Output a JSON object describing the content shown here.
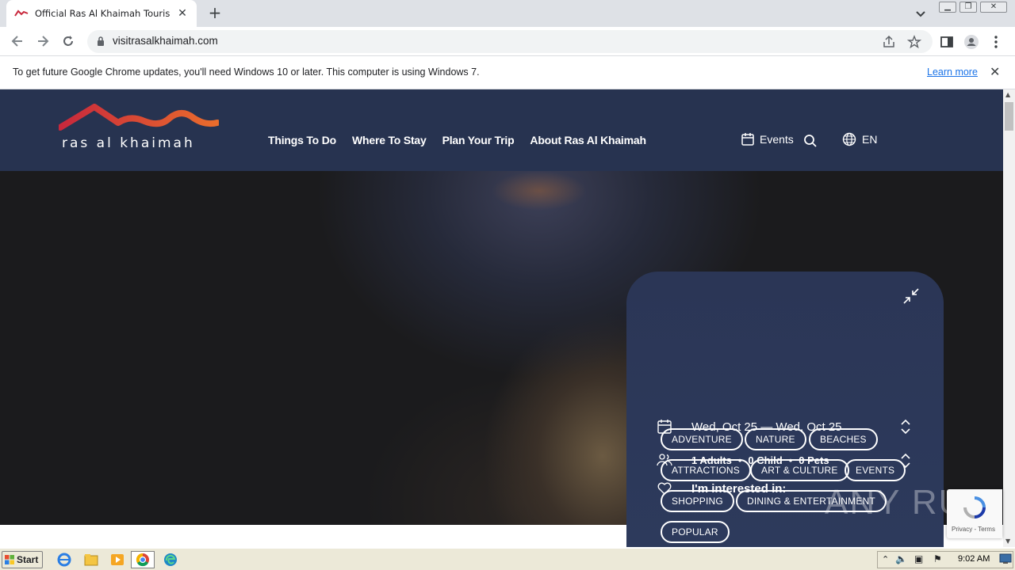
{
  "browser": {
    "tab_title": "Official Ras Al Khaimah Tourism and Vi",
    "url": "visitrasalkhaimah.com",
    "infobar_text": "To get future Google Chrome updates, you'll need Windows 10 or later. This computer is using Windows 7.",
    "infobar_link": "Learn more"
  },
  "site": {
    "logo_text": "ras al khaimah",
    "nav": [
      "Things To Do",
      "Where To Stay",
      "Plan Your Trip",
      "About Ras Al Khaimah"
    ],
    "events_label": "Events",
    "language": "EN"
  },
  "panel": {
    "dates": "Wed, Oct 25 — Wed, Oct 25",
    "adults": "1 Adults",
    "child": "0 Child",
    "pets": "0 Pets",
    "bullet": "•",
    "interest_label": "I'm interested in:",
    "chips": [
      "ADVENTURE",
      "NATURE",
      "BEACHES",
      "ATTRACTIONS",
      "ART & CULTURE",
      "EVENTS",
      "SHOPPING",
      "DINING & ENTERTAINMENT",
      "POPULAR"
    ]
  },
  "recaptcha": {
    "links": "Privacy - Terms"
  },
  "watermark": "ANY RUN",
  "taskbar": {
    "start": "Start",
    "clock": "9:02 AM"
  },
  "colors": {
    "header_bg": "#273350",
    "panel_bg": "#2b3656",
    "logo_red": "#c8283c",
    "logo_orange": "#e86a2c"
  }
}
